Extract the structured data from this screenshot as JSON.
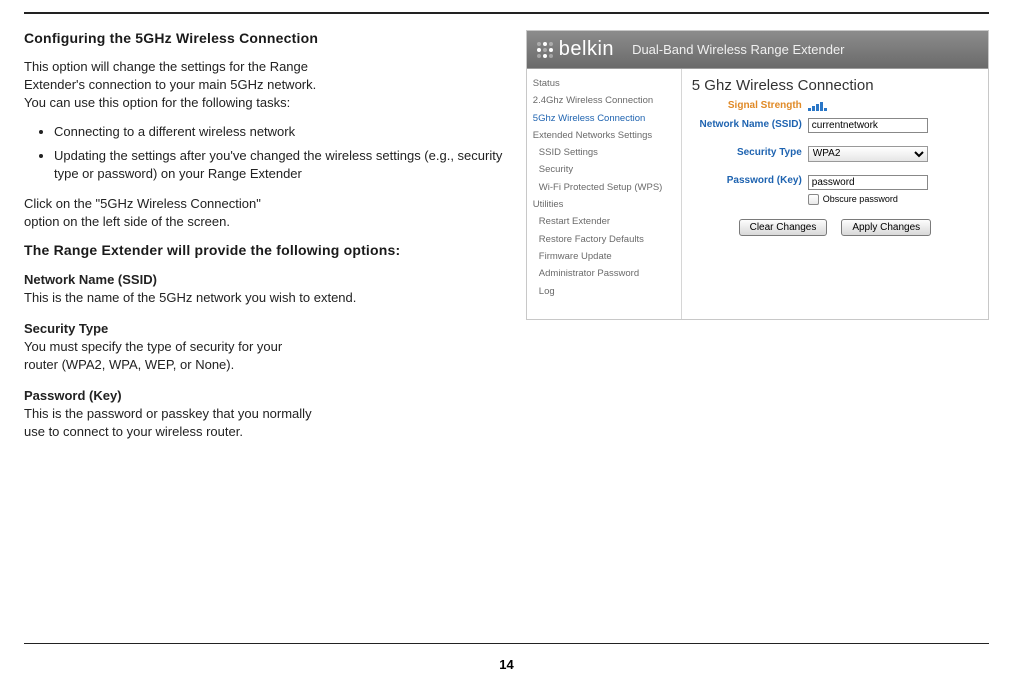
{
  "doc": {
    "heading": "Configuring the 5GHz Wireless Connection",
    "intro_a": "This option will change the settings for the Range",
    "intro_b": "Extender's connection to your main 5GHz network.",
    "intro_c": "You can use this option for the following tasks:",
    "bullets": [
      "Connecting to a different wireless network",
      "Updating the settings after you've changed the wireless settings (e.g., security type or password) on your Range Extender"
    ],
    "click_a": "Click on the \"5GHz Wireless Connection\"",
    "click_b": "option on the left side of the screen.",
    "options_heading": "The Range Extender will provide the following options:",
    "ssid_head": "Network Name (SSID)",
    "ssid_text": "This is the name of the 5GHz network you wish to extend.",
    "sec_head": "Security Type",
    "sec_text_a": "You must specify the type of security for your",
    "sec_text_b": "router (WPA2, WPA, WEP, or None).",
    "pwd_head": "Password (Key)",
    "pwd_text_a": "This is the password or passkey that you normally",
    "pwd_text_b": "use to connect to your wireless router."
  },
  "admin": {
    "brand": "belkin",
    "header_sub": "Dual-Band Wireless Range Extender",
    "nav": {
      "status": "Status",
      "conn24": "2.4Ghz Wireless Connection",
      "conn5": "5Ghz Wireless Connection",
      "ext_head": "Extended Networks Settings",
      "ssid_set": "SSID Settings",
      "security": "Security",
      "wps": "Wi-Fi Protected Setup (WPS)",
      "util_head": "Utilities",
      "restart": "Restart Extender",
      "restore": "Restore Factory Defaults",
      "fw": "Firmware Update",
      "adminpw": "Administrator Password",
      "log": "Log"
    },
    "content": {
      "title": "5 Ghz Wireless Connection",
      "signal_label": "Signal Strength",
      "ssid_label": "Network Name (SSID)",
      "ssid_value": "currentnetwork",
      "sectype_label": "Security Type",
      "sectype_value": "WPA2",
      "pwd_label": "Password (Key)",
      "pwd_value": "password",
      "obscure_label": "Obscure password",
      "clear_btn": "Clear Changes",
      "apply_btn": "Apply Changes"
    }
  },
  "page_number": "14"
}
